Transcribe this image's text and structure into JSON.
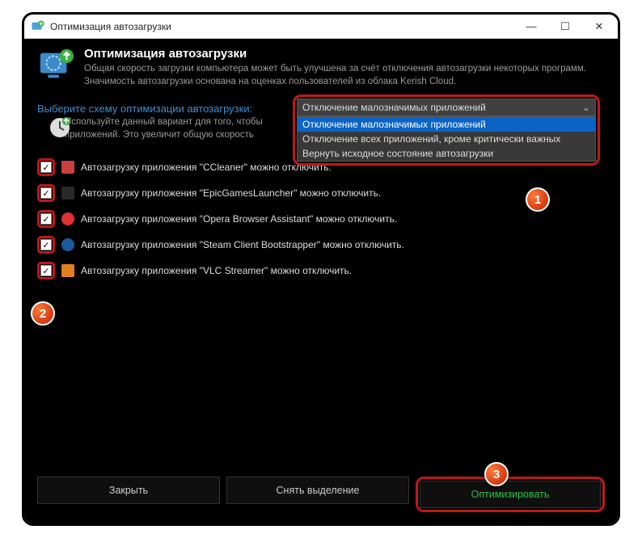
{
  "window": {
    "title": "Оптимизация автозагрузки"
  },
  "header": {
    "title": "Оптимизация автозагрузки",
    "description": "Общая скорость загрузки компьютера может быть улучшена за счёт отключения автозагрузки некоторых программ. Значимость автозагрузки основана на оценках пользователей из облака Kerish Cloud."
  },
  "scheme": {
    "label": "Выберите схему оптимизации автозагрузки:",
    "selected": "Отключение малозначимых приложений",
    "options": [
      "Отключение малозначимых приложений",
      "Отключение всех приложений, кроме критически важных",
      "Вернуть исходное состояние автозагрузки"
    ],
    "hint": "Используйте данный вариант для того, чтобы приложений. Это увеличит общую скорость"
  },
  "items": [
    {
      "text": "Автозагрузку приложения \"CCleaner\" можно отключить.",
      "color": "#c84040"
    },
    {
      "text": "Автозагрузку приложения \"EpicGamesLauncher\" можно отключить.",
      "color": "#2a2a2a"
    },
    {
      "text": "Автозагрузку приложения \"Opera Browser Assistant\" можно отключить.",
      "color": "#e03030"
    },
    {
      "text": "Автозагрузку приложения \"Steam Client Bootstrapper\" можно отключить.",
      "color": "#1b5a9c"
    },
    {
      "text": "Автозагрузку приложения \"VLC Streamer\" можно отключить.",
      "color": "#e08020"
    }
  ],
  "footer": {
    "close": "Закрыть",
    "deselect": "Снять выделение",
    "optimize": "Оптимизировать"
  },
  "badges": {
    "b1": "1",
    "b2": "2",
    "b3": "3"
  }
}
